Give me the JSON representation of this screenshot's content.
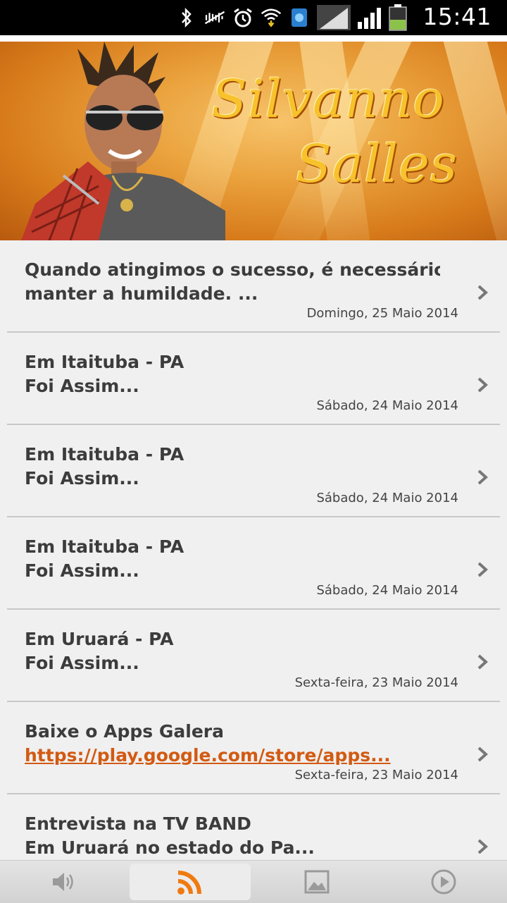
{
  "status_bar": {
    "time": "15:41",
    "icons": [
      "bluetooth-icon",
      "mute-icon",
      "alarm-icon",
      "wifi-icon",
      "app-notification-icon",
      "signal-icon",
      "signal-icon",
      "battery-icon"
    ]
  },
  "banner": {
    "title_line1": "Silvanno",
    "title_line2": "Salles"
  },
  "feed": {
    "items": [
      {
        "title": "Quando atingimos o sucesso, é necessário",
        "subtitle": "manter a humildade. ...",
        "date": "Domingo, 25 Maio 2014"
      },
      {
        "title": "Em Itaituba - PA",
        "subtitle": "Foi Assim...",
        "date": "Sábado, 24 Maio 2014"
      },
      {
        "title": "Em Itaituba - PA",
        "subtitle": "Foi Assim...",
        "date": "Sábado, 24 Maio 2014"
      },
      {
        "title": "Em Itaituba - PA",
        "subtitle": "Foi Assim...",
        "date": "Sábado, 24 Maio 2014"
      },
      {
        "title": "Em Uruará - PA",
        "subtitle": "Foi Assim...",
        "date": "Sexta-feira, 23 Maio 2014"
      },
      {
        "title": "Baixe o Apps Galera",
        "subtitle": "https://play.google.com/store/apps...",
        "date": "Sexta-feira, 23 Maio 2014"
      },
      {
        "title": "Entrevista na TV BAND",
        "subtitle": "Em Uruará no estado do Pa...",
        "date": ""
      }
    ]
  },
  "tabbar": {
    "tabs": [
      "speaker-icon",
      "rss-icon",
      "image-icon",
      "play-icon"
    ],
    "active": "rss-icon"
  },
  "colors": {
    "link": "#d25a12",
    "accent": "#f07a10"
  }
}
